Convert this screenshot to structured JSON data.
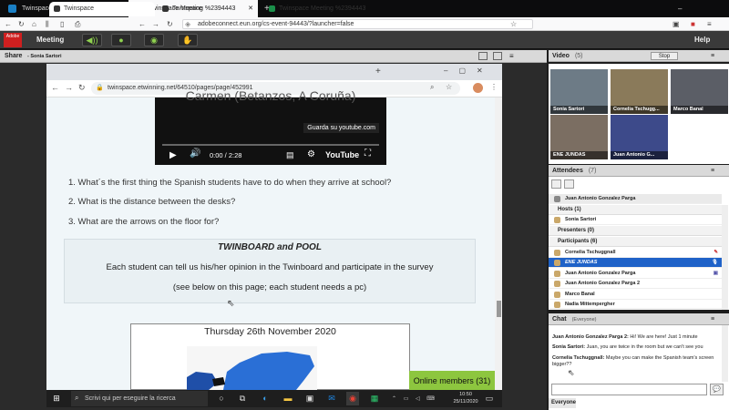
{
  "outer_browser": {
    "tabs": [
      {
        "label": "Twinspace",
        "active": false
      },
      {
        "label": "Twinspace Meeting %2394443",
        "active": true
      }
    ],
    "url": "adobeconnect.eun.org/cs-event-94443/?launcher=false"
  },
  "adobe": {
    "logo_text": "Adobe",
    "menu_meeting": "Meeting",
    "menu_help": "Help"
  },
  "share": {
    "title": "Share",
    "presenter": "- Sonia Sartori"
  },
  "inner_browser": {
    "tabs": [
      {
        "label": "Twinspace"
      },
      {
        "label": "Twinspace"
      },
      {
        "label": "Twinspace Meeting %2394443"
      }
    ],
    "url": "twinspace.etwinning.net/64510/pages/page/452991"
  },
  "page": {
    "video_caption": "Carmen (Betanzos, A Coruña)",
    "video_watch": "Guarda su youtube.com",
    "video_time": "0:00 / 2:28",
    "video_brand": "YouTube",
    "questions": [
      "1. What´s the first thing the Spanish students have to do when they arrive at school?",
      "2. What is the distance between the desks?",
      "3. What are the arrows on the floor for?"
    ],
    "twin_title": "TWINBOARD and POOL",
    "twin_line1": "Each student can tell us his/her opinion in the Twinboard and participate in the survey",
    "twin_line2": "(see below on this page; each student needs a pc)",
    "date_heading": "Thursday 26th November 2020",
    "online_members": "Online members (31)"
  },
  "taskbar": {
    "search_placeholder": "Scrivi qui per eseguire la ricerca",
    "time": "10:50",
    "date": "25/11/2020"
  },
  "video_pod": {
    "title": "Video",
    "count": "(5)",
    "stop_label": "Stop",
    "participants": [
      "Sonia Sartori",
      "Cornelia Tschugg...",
      "Marco Banal",
      "ENE JUNDAS",
      "Juan Antonio G..."
    ]
  },
  "attendees": {
    "title": "Attendees",
    "count": "(7)",
    "me": "Juan Antonio Gonzalez Parga",
    "groups": {
      "hosts": "Hosts (1)",
      "presenters": "Presenters (0)",
      "participants": "Participants (6)"
    },
    "hosts": [
      "Sonia Sartori"
    ],
    "participants": [
      "Cornelia Tschuggnall",
      "ENE JUNDAS",
      "Juan Antonio Gonzalez Parga",
      "Juan Antonio Gonzalez Parga 2",
      "Marco Banal",
      "Nadia Mittempergher"
    ]
  },
  "chat": {
    "title": "Chat",
    "scope": "(Everyone)",
    "messages": [
      {
        "from": "Juan Antonio Gonzalez Parga 2:",
        "text": "Hi! We are here! Just 1 minute"
      },
      {
        "from": "Sonia Sartori:",
        "text": "Juan, you are twice in the room but we can't see you"
      },
      {
        "from": "Cornelia Tschuggnall:",
        "text": "Maybe you can make the Spanish team's screen bigger??"
      }
    ],
    "tab": "Everyone"
  },
  "colors": {
    "accent_green": "#8dc63f",
    "adobe_red": "#cf1f1f",
    "selected_row": "#1f62c8"
  }
}
